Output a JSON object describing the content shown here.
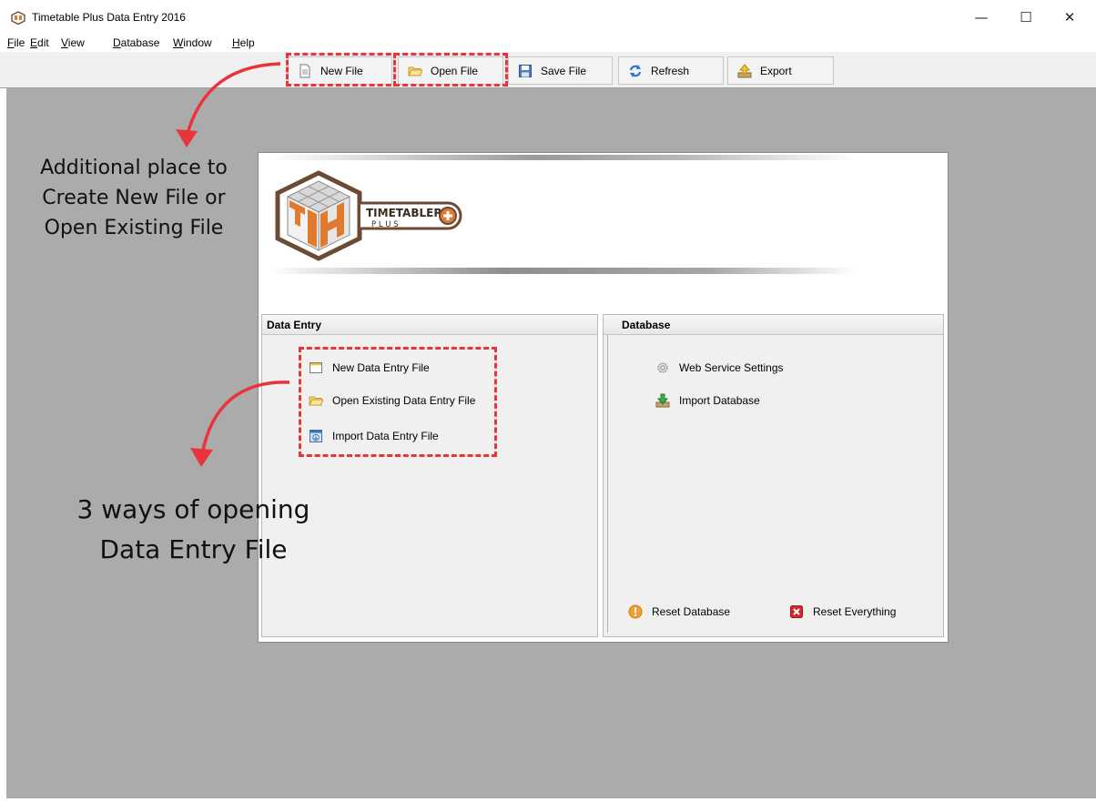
{
  "window": {
    "title": "Timetable Plus Data Entry 2016",
    "minimize_glyph": "—",
    "maximize_glyph": "☐",
    "close_glyph": "✕"
  },
  "menu": [
    {
      "prefix": "",
      "underline": "F",
      "suffix": "ile"
    },
    {
      "prefix": "",
      "underline": "E",
      "suffix": "dit"
    },
    {
      "prefix": "",
      "underline": "V",
      "suffix": "iew"
    },
    {
      "prefix": "",
      "underline": "D",
      "suffix": "atabase"
    },
    {
      "prefix": "",
      "underline": "W",
      "suffix": "indow"
    },
    {
      "prefix": "",
      "underline": "H",
      "suffix": "elp"
    }
  ],
  "toolbar": {
    "new_file": "New File",
    "open_file": "Open File",
    "save_file": "Save File",
    "refresh": "Refresh",
    "export": "Export"
  },
  "logo": {
    "brand": "TIMETABLER",
    "sub": "P L U S"
  },
  "data_entry": {
    "header": "Data Entry",
    "items": [
      {
        "label": "New Data Entry File",
        "icon": "new-document-icon"
      },
      {
        "label": "Open Existing Data Entry File",
        "icon": "folder-open-icon"
      },
      {
        "label": "Import Data Entry File",
        "icon": "import-file-icon"
      }
    ]
  },
  "database": {
    "header": "Database",
    "items": [
      {
        "label": "Web Service Settings",
        "icon": "gear-icon"
      },
      {
        "label": "Import Database",
        "icon": "download-icon"
      }
    ],
    "reset_database": "Reset Database",
    "reset_everything": "Reset Everything"
  },
  "annotations": {
    "toolbar_note_lines": [
      "Additional place to",
      "Create New File or",
      "Open Existing File"
    ],
    "panel_note_lines": [
      "3 ways of opening",
      "Data Entry File"
    ]
  },
  "colors": {
    "annotation_red": "#e8343a",
    "mdi_background": "#ababab",
    "logo_orange": "#e07a2e",
    "logo_brown": "#6b4a36"
  }
}
